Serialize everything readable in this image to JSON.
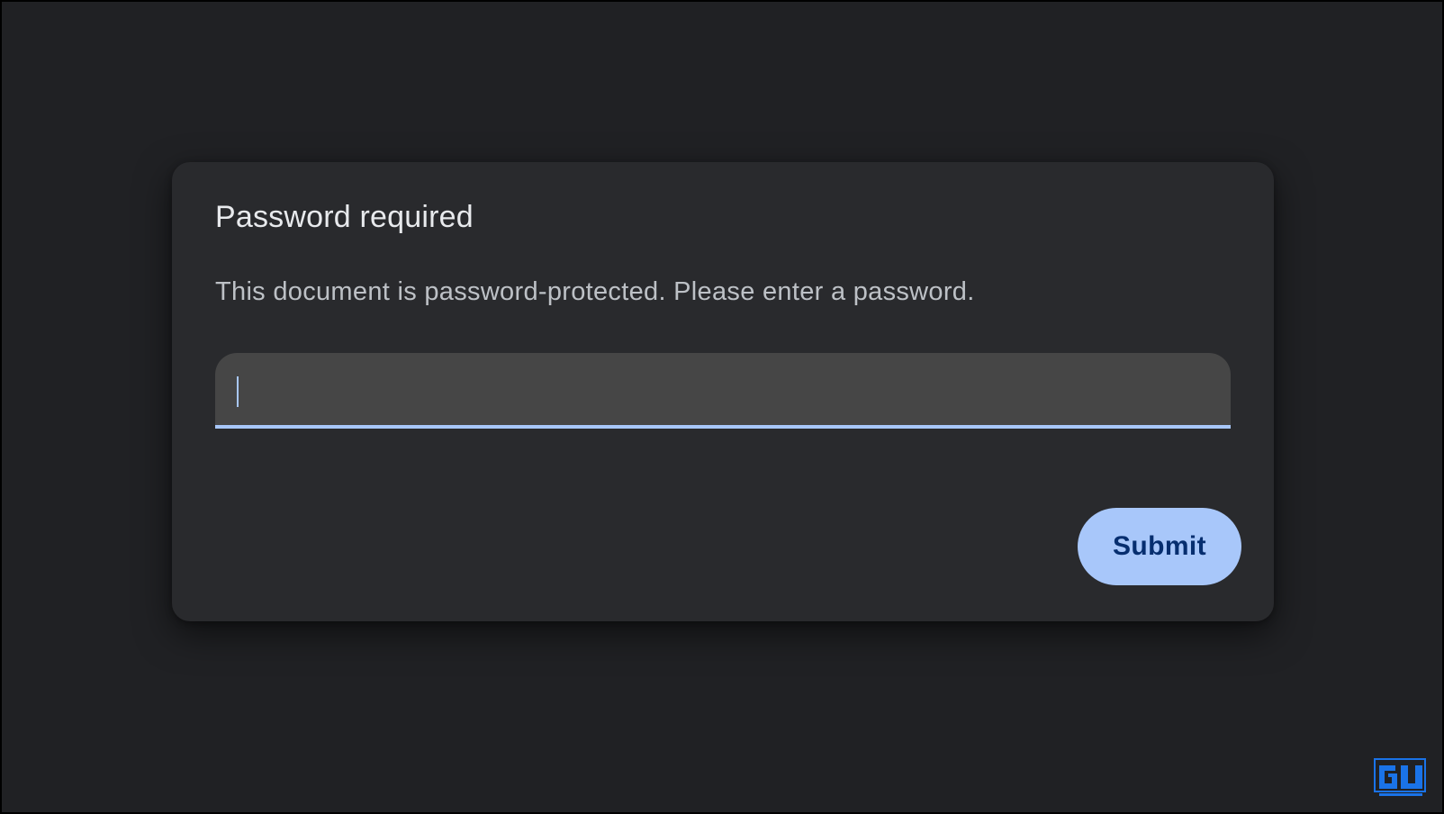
{
  "dialog": {
    "title": "Password required",
    "message": "This document is password-protected. Please enter a password.",
    "password_input": {
      "value": "",
      "placeholder": ""
    },
    "submit_label": "Submit"
  },
  "colors": {
    "background": "#202124",
    "dialog": "#292a2d",
    "input_fill": "#464646",
    "accent": "#a8c7fa",
    "button_text": "#062e6f"
  },
  "watermark": {
    "icon": "gadgets-to-use-logo-icon"
  }
}
